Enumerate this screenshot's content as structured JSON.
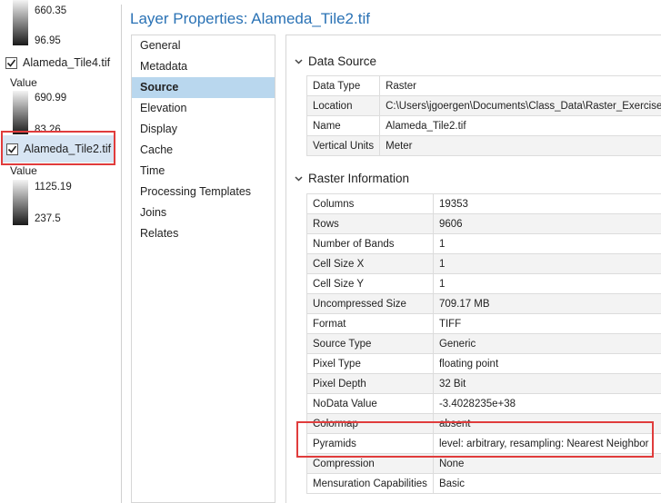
{
  "toc": {
    "top_ramp": {
      "max": "660.35",
      "min": "96.95"
    },
    "layer1": {
      "name": "Alameda_Tile4.tif",
      "checked": true,
      "value_header": "Value",
      "max": "690.99",
      "min": "83.26"
    },
    "layer2": {
      "name": "Alameda_Tile2.tif",
      "checked": true,
      "value_header": "Value",
      "max": "1125.19",
      "min": "237.5"
    }
  },
  "dialog": {
    "title": "Layer Properties: Alameda_Tile2.tif",
    "nav": [
      "General",
      "Metadata",
      "Source",
      "Elevation",
      "Display",
      "Cache",
      "Time",
      "Processing Templates",
      "Joins",
      "Relates"
    ],
    "active_nav": "Source"
  },
  "data_source": {
    "header": "Data Source",
    "rows": [
      [
        "Data Type",
        "Raster"
      ],
      [
        "Location",
        "C:\\Users\\jgoergen\\Documents\\Class_Data\\Raster_Exercises"
      ],
      [
        "Name",
        "Alameda_Tile2.tif"
      ],
      [
        "Vertical Units",
        "Meter"
      ]
    ]
  },
  "raster_info": {
    "header": "Raster Information",
    "rows": [
      [
        "Columns",
        "19353"
      ],
      [
        "Rows",
        "9606"
      ],
      [
        "Number of Bands",
        "1"
      ],
      [
        "Cell Size X",
        "1"
      ],
      [
        "Cell Size Y",
        "1"
      ],
      [
        "Uncompressed Size",
        "709.17 MB"
      ],
      [
        "Format",
        "TIFF"
      ],
      [
        "Source Type",
        "Generic"
      ],
      [
        "Pixel Type",
        "floating point"
      ],
      [
        "Pixel Depth",
        "32 Bit"
      ],
      [
        "NoData Value",
        "-3.4028235e+38"
      ],
      [
        "Colormap",
        "absent"
      ],
      [
        "Pyramids",
        "level: arbitrary, resampling: Nearest Neighbor"
      ],
      [
        "Compression",
        "None"
      ],
      [
        "Mensuration Capabilities",
        "Basic"
      ]
    ]
  },
  "colors": {
    "accent": "#2a72b5",
    "highlight": "#e03c3c",
    "selected_nav": "#b9d7ee"
  }
}
